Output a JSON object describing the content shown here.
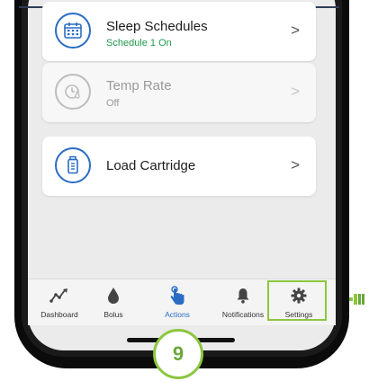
{
  "menu": {
    "items": [
      {
        "title": "Sleep Schedules",
        "subtitle": "Schedule 1 On",
        "icon": "calendar-icon",
        "enabled": true
      },
      {
        "title": "Temp Rate",
        "subtitle": "Off",
        "icon": "temp-rate-icon",
        "enabled": false
      },
      {
        "title": "Load Cartridge",
        "subtitle": "",
        "icon": "cartridge-icon",
        "enabled": true
      }
    ],
    "chevron": ">"
  },
  "tabbar": {
    "tabs": [
      {
        "label": "Dashboard",
        "icon": "trend-graph-icon"
      },
      {
        "label": "Bolus",
        "icon": "drop-icon"
      },
      {
        "label": "Actions",
        "icon": "tap-hand-icon",
        "active": true
      },
      {
        "label": "Notifications",
        "icon": "bell-icon"
      },
      {
        "label": "Settings",
        "icon": "gear-icon"
      }
    ]
  },
  "step": {
    "number": "9"
  },
  "colors": {
    "accent": "#2a6cc4",
    "highlight": "#8cc63f",
    "status_on": "#1f9a4a"
  }
}
